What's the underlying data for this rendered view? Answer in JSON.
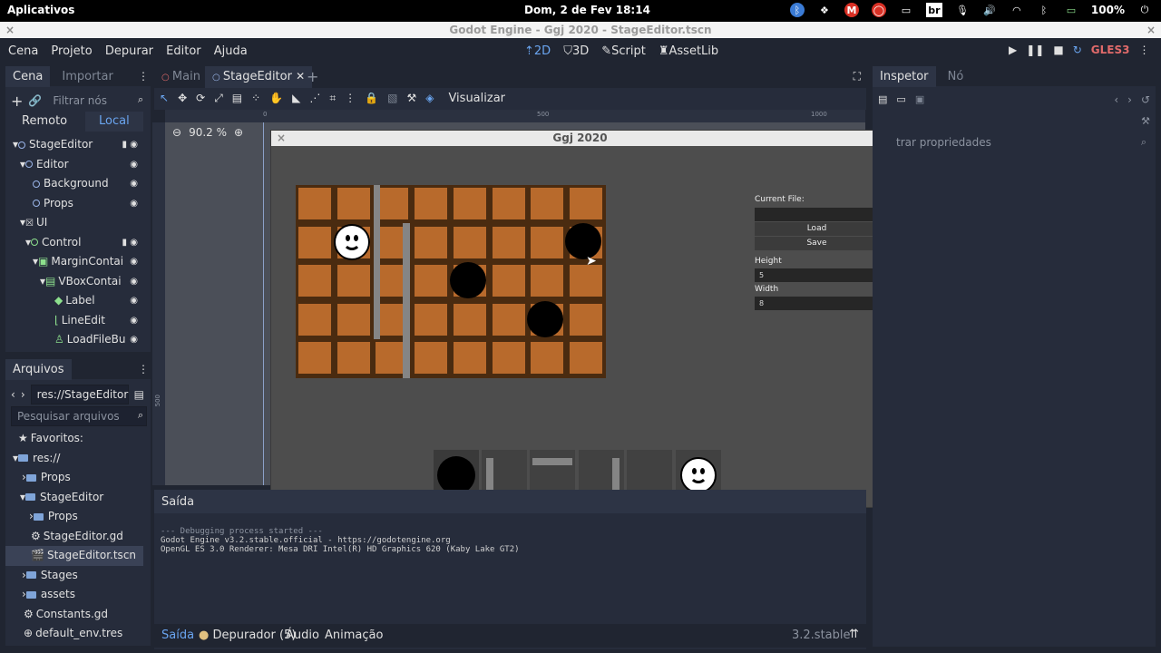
{
  "system_bar": {
    "app_menu": "Aplicativos",
    "clock": "Dom,  2 de Fev   18:14",
    "battery": "100%",
    "keyboard_layout": "br"
  },
  "window_title": "Godot Engine - Ggj 2020 - StageEditor.tscn",
  "menu": {
    "items": [
      "Cena",
      "Projeto",
      "Depurar",
      "Editor",
      "Ajuda"
    ],
    "workspaces": [
      "2D",
      "3D",
      "Script",
      "AssetLib"
    ],
    "renderer": "GLES3"
  },
  "scene_dock": {
    "tabs": [
      "Cena",
      "Importar"
    ],
    "filter_placeholder": "Filtrar nós",
    "remote_label": "Remoto",
    "local_label": "Local",
    "tree": [
      {
        "label": "StageEditor"
      },
      {
        "label": "Editor"
      },
      {
        "label": "Background"
      },
      {
        "label": "Props"
      },
      {
        "label": "UI"
      },
      {
        "label": "Control"
      },
      {
        "label": "MarginContai"
      },
      {
        "label": "VBoxContai"
      },
      {
        "label": "Label"
      },
      {
        "label": "LineEdit"
      },
      {
        "label": "LoadFileBu"
      }
    ]
  },
  "filesystem_dock": {
    "title": "Arquivos",
    "path": "res://StageEditor",
    "search_placeholder": "Pesquisar arquivos",
    "tree": [
      {
        "label": "Favoritos:"
      },
      {
        "label": "res://"
      },
      {
        "label": "Props"
      },
      {
        "label": "StageEditor"
      },
      {
        "label": "Props"
      },
      {
        "label": "StageEditor.gd"
      },
      {
        "label": "StageEditor.tscn"
      },
      {
        "label": "Stages"
      },
      {
        "label": "assets"
      },
      {
        "label": "Constants.gd"
      },
      {
        "label": "default_env.tres"
      }
    ]
  },
  "editor_tabs": [
    "Main",
    "StageEditor"
  ],
  "viewport_toolbar": {
    "view_label": "Visualizar",
    "zoom": "90.2 %",
    "ruler_marks": [
      "0",
      "500",
      "1000"
    ],
    "ruler_left_mark": "500"
  },
  "game_window": {
    "title": "Ggj 2020",
    "current_file_label": "Current File:",
    "current_file_value": "",
    "load_label": "Load",
    "save_label": "Save",
    "height_label": "Height",
    "height_value": "5",
    "width_label": "Width",
    "width_value": "8"
  },
  "output_panel": {
    "title": "Saída",
    "lines": [
      "--- Debugging process started ---",
      "Godot Engine v3.2.stable.official - https://godotengine.org",
      "OpenGL ES 3.0 Renderer: Mesa DRI Intel(R) HD Graphics 620 (Kaby Lake GT2)"
    ],
    "bottom_tabs": [
      "Saída",
      "Depurador (5)",
      "Áudio",
      "Animação"
    ],
    "version": "3.2.stable"
  },
  "inspector": {
    "tabs": [
      "Inspetor",
      "Nó"
    ],
    "filter_placeholder": "trar propriedades"
  }
}
